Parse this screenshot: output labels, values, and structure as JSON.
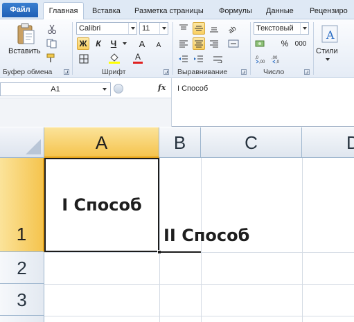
{
  "ribbon": {
    "tabs": {
      "file": "Файл",
      "home": "Главная",
      "insert": "Вставка",
      "page_layout": "Разметка страницы",
      "formulas": "Формулы",
      "data": "Данные",
      "review": "Рецензиро"
    },
    "clipboard": {
      "paste_label": "Вставить",
      "group_label": "Буфер обмена"
    },
    "font": {
      "font_name": "Calibri",
      "font_size": "11",
      "bold": "Ж",
      "italic": "К",
      "underline": "Ч",
      "grow": "A",
      "shrink": "A",
      "font_color": "A",
      "group_label": "Шрифт"
    },
    "alignment": {
      "group_label": "Выравнивание"
    },
    "number": {
      "format": "Текстовый",
      "percent": "%",
      "thousands": "000",
      "group_label": "Число"
    },
    "styles": {
      "label": "Стили"
    },
    "colors": {
      "accent": "#f5c44e",
      "file_tab": "#2a6dc4",
      "font_color_bar": "#e02020",
      "fill_color_bar": "#ffff00"
    }
  },
  "formula_bar": {
    "name_box": "A1",
    "fx": "fx",
    "value": "I Способ"
  },
  "grid": {
    "columns": [
      "A",
      "B",
      "C",
      "D"
    ],
    "rows": [
      "1",
      "2",
      "3"
    ],
    "cell_a1": "I Способ",
    "cell_b1": "II Способ"
  }
}
